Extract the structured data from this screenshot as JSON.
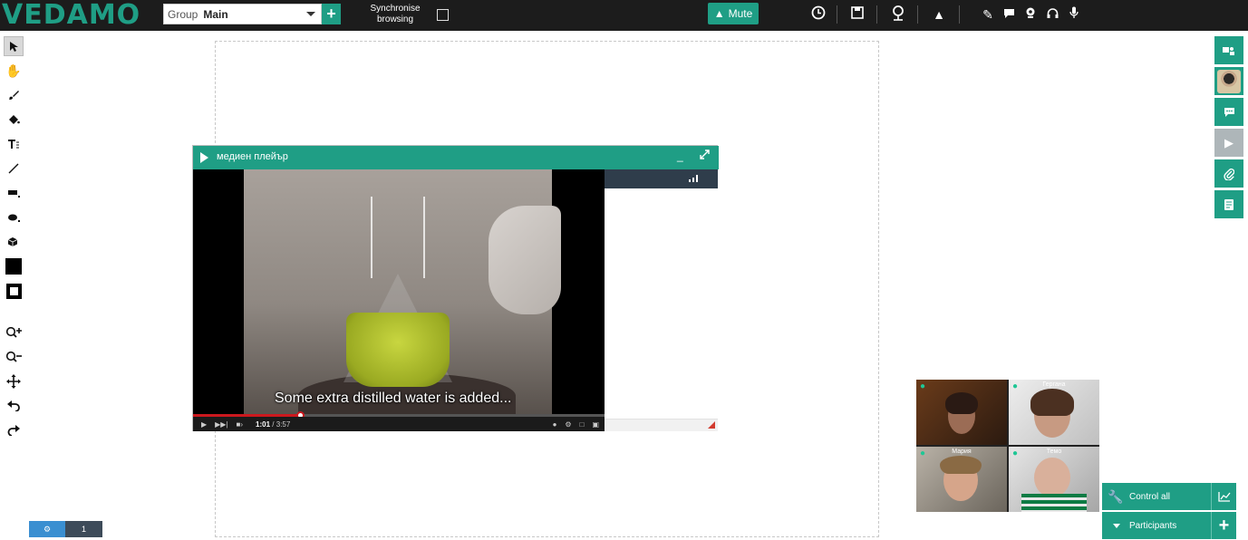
{
  "app": {
    "logo": "VEDAMO"
  },
  "topbar": {
    "group_label": "Group",
    "group_value": "Main",
    "add_label": "+",
    "sync_label": "Synchronise browsing",
    "mute_label": "Mute",
    "icons": [
      "clock-icon",
      "save-icon",
      "location-icon",
      "bell-icon",
      "pen-icon",
      "chat-icon",
      "webcam-icon",
      "headphones-icon",
      "microphone-icon"
    ]
  },
  "left_tools": [
    "select",
    "hand",
    "brush",
    "fill",
    "text",
    "line",
    "rectangle",
    "ellipse",
    "cube",
    "fill-color",
    "stroke-color",
    "zoom-in",
    "zoom-out",
    "move",
    "undo",
    "redo"
  ],
  "media_player": {
    "title": "медиен плейър",
    "subtitle": "Some extra distilled water is added...",
    "current_time": "1:01",
    "duration": "3:57",
    "progress": 0.26
  },
  "participants_panel": {
    "tiles": [
      {
        "name": "",
        "mic": "on"
      },
      {
        "name": "Гергана",
        "mic": "on"
      },
      {
        "name": "Мария",
        "mic": "on"
      },
      {
        "name": "Темо",
        "mic": "on"
      }
    ],
    "control_all_label": "Control all",
    "participants_label": "Participants"
  },
  "page_nav": {
    "page": "1"
  },
  "colors": {
    "accent": "#1f9e85",
    "topbar": "#1c1c1c",
    "panel_header": "#2f3d4b",
    "page_blue": "#3a8fd1"
  }
}
